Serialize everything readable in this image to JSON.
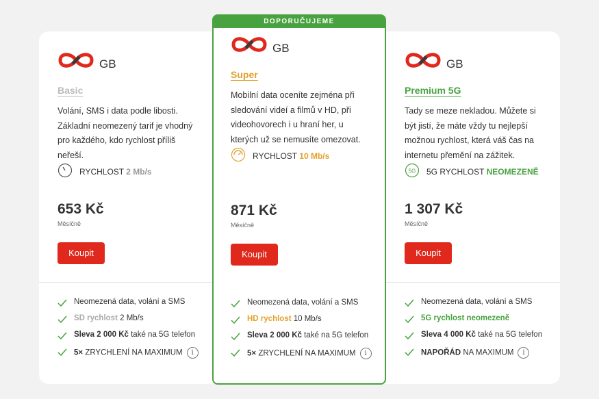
{
  "colors": {
    "brand_red": "#e0281c",
    "featured_green": "#48a23f",
    "super_orange": "#e2a12a",
    "basic_gray": "#bbbbbb"
  },
  "plans": [
    {
      "data_unit": "GB",
      "name": "Basic",
      "description": "Volání, SMS i data podle libosti. Základní neomezený tarif je vhodný pro každého, kdo rychlost příliš neřeší.",
      "speed_label": "RYCHLOST",
      "speed_value": "2 Mb/s",
      "speed_icon": "speedometer-low-icon",
      "price": "653 Kč",
      "period": "Měsíčně",
      "buy_label": "Koupit",
      "features": [
        {
          "text": "Neomezená data, volání a SMS"
        },
        {
          "hl": "SD rychlost",
          "rest": " 2 Mb/s"
        },
        {
          "bold": "Sleva 2 000 Kč",
          "rest": " také na 5G telefon"
        },
        {
          "bold": "5× ",
          "rest": "ZRYCHLENÍ NA MAXIMUM",
          "info": "i"
        }
      ]
    },
    {
      "banner": "DOPORUČUJEME",
      "data_unit": "GB",
      "name": "Super",
      "description": "Mobilní data oceníte zejména při sledování videí a filmů v HD, při videohovorech i u hraní her, u kterých už se nemusíte omezovat.",
      "speed_label": "RYCHLOST",
      "speed_value": "10 Mb/s",
      "speed_icon": "speedometer-medium-icon",
      "price": "871 Kč",
      "period": "Měsíčně",
      "buy_label": "Koupit",
      "features": [
        {
          "text": "Neomezená data, volání a SMS"
        },
        {
          "hl": "HD rychlost",
          "rest": " 10 Mb/s"
        },
        {
          "bold": "Sleva 2 000 Kč",
          "rest": " také na 5G telefon"
        },
        {
          "bold": "5× ",
          "rest": "ZRYCHLENÍ NA MAXIMUM",
          "info": "i"
        }
      ]
    },
    {
      "data_unit": "GB",
      "name": "Premium 5G",
      "description": "Tady se meze nekladou. Můžete si být jistí, že máte vždy tu nejlepší možnou rychlost, která váš čas na internetu přemění na zážitek.",
      "speed_label": "5G RYCHLOST",
      "speed_value": "NEOMEZENĚ",
      "speed_icon": "5g-badge-icon",
      "speed_icon_text": "5G",
      "price": "1 307 Kč",
      "period": "Měsíčně",
      "buy_label": "Koupit",
      "features": [
        {
          "text": "Neomezená data, volání a SMS"
        },
        {
          "hl": "5G rychlost neomezeně",
          "rest": ""
        },
        {
          "bold": "Sleva 4 000 Kč",
          "rest": " také na 5G telefon"
        },
        {
          "bold": "NAPOŘÁD",
          "rest": " NA MAXIMUM",
          "info": "i"
        }
      ]
    }
  ]
}
